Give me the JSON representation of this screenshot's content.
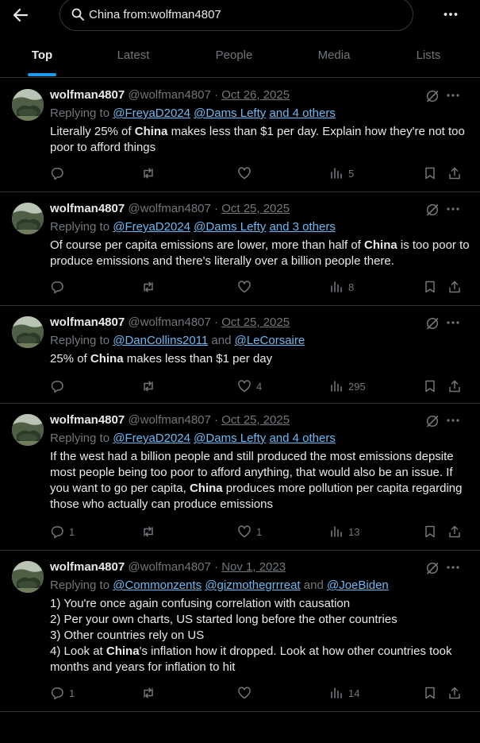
{
  "search": {
    "query": "China from:wolfman4807"
  },
  "tabs": [
    "Top",
    "Latest",
    "People",
    "Media",
    "Lists"
  ],
  "highlight_term": "China",
  "tweets": [
    {
      "name": "wolfman4807",
      "handle": "@wolfman4807",
      "separator": "·",
      "date": "Oct 26, 2025",
      "replying_prefix": "Replying to",
      "mentions": [
        "@FreyaD2024",
        "@Dams Lefty"
      ],
      "conjunction": "",
      "others": "and 4 others",
      "body_parts": [
        "Literally 25% of ",
        "China",
        " makes less than $1 per day. Explain how they're not too poor to afford things"
      ],
      "stats": {
        "replies": "",
        "reposts": "",
        "likes": "",
        "views": "5"
      }
    },
    {
      "name": "wolfman4807",
      "handle": "@wolfman4807",
      "separator": "·",
      "date": "Oct 25, 2025",
      "replying_prefix": "Replying to",
      "mentions": [
        "@FreyaD2024",
        "@Dams Lefty"
      ],
      "conjunction": "",
      "others": "and 3 others",
      "body_parts": [
        "Of course per capita emissions are lower, more than half of ",
        "China",
        " is too poor to produce emissions and there's literally over a billion people there."
      ],
      "stats": {
        "replies": "",
        "reposts": "",
        "likes": "",
        "views": "8"
      }
    },
    {
      "name": "wolfman4807",
      "handle": "@wolfman4807",
      "separator": "·",
      "date": "Oct 25, 2025",
      "replying_prefix": "Replying to",
      "mentions": [
        "@DanCollins2011",
        "@LeCorsaire"
      ],
      "conjunction": "and",
      "others": "",
      "body_parts": [
        "25% of ",
        "China",
        " makes less than $1 per day"
      ],
      "stats": {
        "replies": "",
        "reposts": "",
        "likes": "4",
        "views": "295"
      }
    },
    {
      "name": "wolfman4807",
      "handle": "@wolfman4807",
      "separator": "·",
      "date": "Oct 25, 2025",
      "replying_prefix": "Replying to",
      "mentions": [
        "@FreyaD2024",
        "@Dams Lefty"
      ],
      "conjunction": "",
      "others": "and 4 others",
      "body_parts": [
        "If the west had a billion people and still produced the most emissions depsite most people being too poor to afford anything, that would also be an issue. If you want to go per capita, ",
        "China",
        " produces more pollution per capita regarding those who actually can produce emissions"
      ],
      "stats": {
        "replies": "1",
        "reposts": "",
        "likes": "1",
        "views": "13"
      }
    },
    {
      "name": "wolfman4807",
      "handle": "@wolfman4807",
      "separator": "·",
      "date": "Nov 1, 2023",
      "replying_prefix": "Replying to",
      "mentions": [
        "@Commonzents",
        "@gizmothegrrreat",
        "@JoeBiden"
      ],
      "conjunction": "and",
      "others": "",
      "body_lines": [
        [
          "1) You're once again confusing correlation with causation"
        ],
        [
          "2) Per your own charts, US started long before the other countries"
        ],
        [
          "3) Other countries rely on US"
        ],
        [
          "4) Look at ",
          "China",
          "'s inflation how it dropped. Look at how other countries took months and years for inflation to hit"
        ]
      ],
      "stats": {
        "replies": "1",
        "reposts": "",
        "likes": "",
        "views": "14"
      }
    }
  ],
  "colors": {
    "accent": "#1d9bf0",
    "mention": "#6fb8ef",
    "muted": "#71767b",
    "divider": "#2f3336",
    "text": "#e7e9ea"
  },
  "icons": [
    "back-arrow-icon",
    "search-icon",
    "more-icon",
    "grok-icon",
    "reply-icon",
    "repost-icon",
    "like-icon",
    "views-icon",
    "bookmark-icon",
    "share-icon"
  ]
}
